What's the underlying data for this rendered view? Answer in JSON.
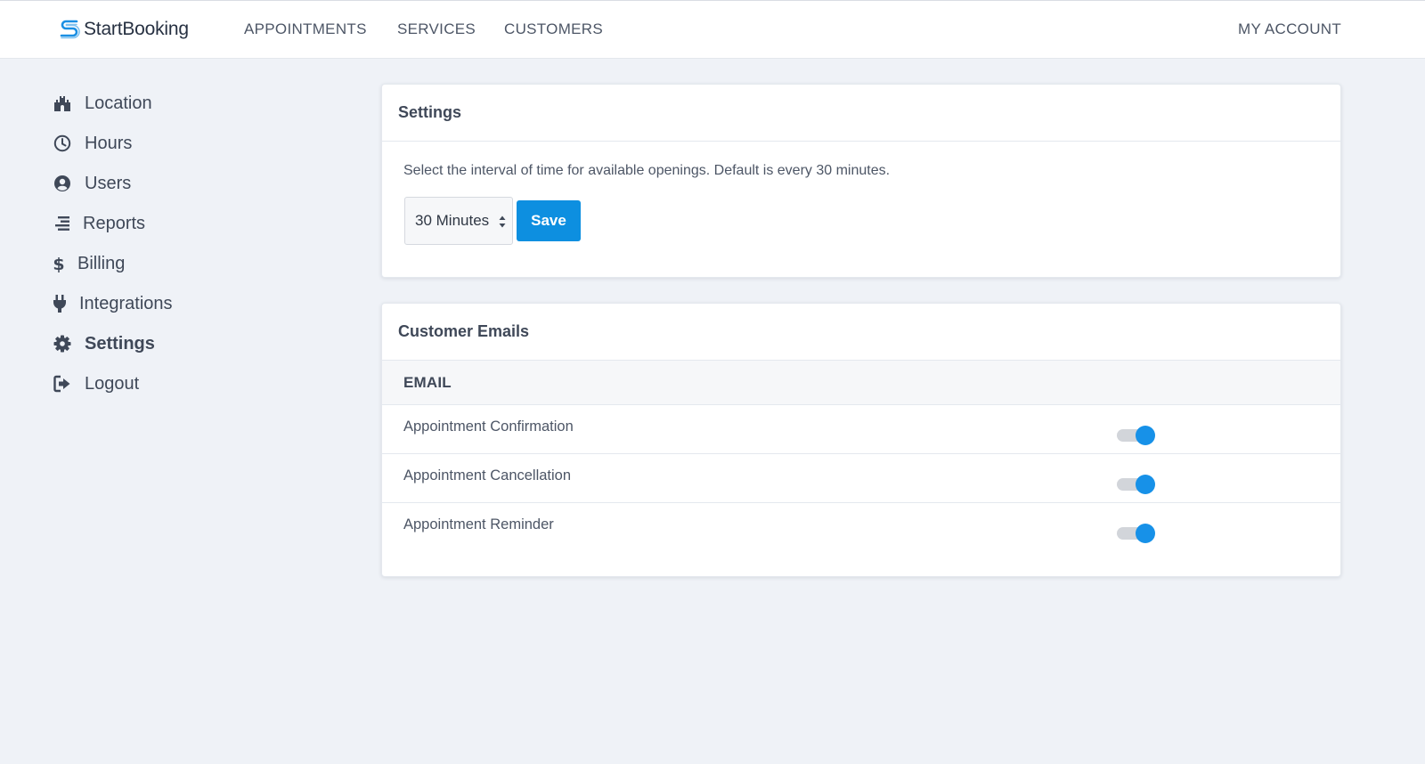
{
  "header": {
    "logo_text": "StartBooking",
    "nav": [
      "APPOINTMENTS",
      "SERVICES",
      "CUSTOMERS"
    ],
    "account": "MY ACCOUNT"
  },
  "sidebar": {
    "items": [
      {
        "label": "Location",
        "icon": "castle-icon"
      },
      {
        "label": "Hours",
        "icon": "clock-icon"
      },
      {
        "label": "Users",
        "icon": "user-circle-icon"
      },
      {
        "label": "Reports",
        "icon": "list-icon"
      },
      {
        "label": "Billing",
        "icon": "dollar-icon"
      },
      {
        "label": "Integrations",
        "icon": "plug-icon"
      },
      {
        "label": "Settings",
        "icon": "gear-icon",
        "active": true
      },
      {
        "label": "Logout",
        "icon": "logout-icon"
      }
    ]
  },
  "settings_card": {
    "title": "Settings",
    "description": "Select the interval of time for available openings. Default is every 30 minutes.",
    "interval_value": "30 Minutes",
    "save_label": "Save"
  },
  "emails_card": {
    "title": "Customer Emails",
    "column_header": "EMAIL",
    "rows": [
      {
        "label": "Appointment Confirmation",
        "enabled": true
      },
      {
        "label": "Appointment Cancellation",
        "enabled": true
      },
      {
        "label": "Appointment Reminder",
        "enabled": true
      }
    ]
  },
  "colors": {
    "accent": "#0d8fe0",
    "background": "#eff2f7",
    "text": "#3f4858"
  }
}
